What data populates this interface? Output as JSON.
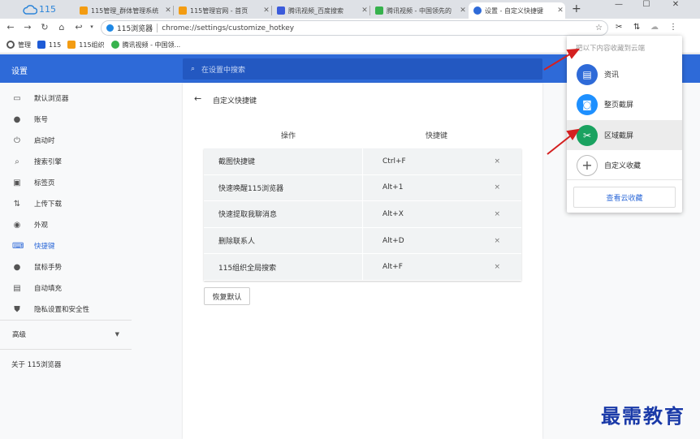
{
  "browser": {
    "logo_text": "115",
    "tabs": [
      {
        "title": "115管理_群体管理系统",
        "icon_color": "#f39c12"
      },
      {
        "title": "115管理官网 - 首页",
        "icon_color": "#f39c12"
      },
      {
        "title": "腾讯视频_百度搜索",
        "icon_color": "#3b5bdb"
      },
      {
        "title": "腾讯视频 - 中国领先的",
        "icon_color": "#37b24d"
      },
      {
        "title": "设置 - 自定义快捷键",
        "icon_color": "#2e6ad8"
      }
    ],
    "site_name": "115浏览器",
    "url": "chrome://settings/customize_hotkey",
    "bookmarks": [
      {
        "label": "管理",
        "icon": "gear-icon",
        "color": "#555555"
      },
      {
        "label": "115",
        "icon": "115-icon",
        "color": "#1e5bd6"
      },
      {
        "label": "115组织",
        "icon": "org-icon",
        "color": "#f39c12"
      },
      {
        "label": "腾讯视频 - 中国领...",
        "icon": "video-icon",
        "color": "#37b24d"
      }
    ]
  },
  "settings": {
    "header_title": "设置",
    "search_placeholder": "在设置中搜索",
    "sidebar": [
      {
        "label": "默认浏览器",
        "icon": "browser-icon",
        "glyph": "▭"
      },
      {
        "label": "账号",
        "icon": "person-icon",
        "glyph": "●"
      },
      {
        "label": "启动时",
        "icon": "power-icon",
        "glyph": "⏻"
      },
      {
        "label": "搜索引擎",
        "icon": "search-icon",
        "glyph": "⌕"
      },
      {
        "label": "标签页",
        "icon": "tabs-icon",
        "glyph": "▣"
      },
      {
        "label": "上传下载",
        "icon": "updown-icon",
        "glyph": "⇅"
      },
      {
        "label": "外观",
        "icon": "palette-icon",
        "glyph": "◉"
      },
      {
        "label": "快捷键",
        "icon": "keyboard-icon",
        "glyph": "⌨"
      },
      {
        "label": "鼠标手势",
        "icon": "mouse-icon",
        "glyph": "●"
      },
      {
        "label": "自动填充",
        "icon": "clipboard-icon",
        "glyph": "▤"
      },
      {
        "label": "隐私设置和安全性",
        "icon": "shield-icon",
        "glyph": "⛊"
      }
    ],
    "advanced_label": "高级",
    "about_label": "关于 115浏览器",
    "page_title": "自定义快捷键",
    "col_action": "操作",
    "col_hotkey": "快捷键",
    "rows": [
      {
        "action": "截图快捷键",
        "key": "Ctrl+F"
      },
      {
        "action": "快速唤醒115浏览器",
        "key": "Alt+1"
      },
      {
        "action": "快速提取我聊消息",
        "key": "Alt+X"
      },
      {
        "action": "删除联系人",
        "key": "Alt+D"
      },
      {
        "action": "115组织全局搜索",
        "key": "Alt+F"
      }
    ],
    "remove_glyph": "×",
    "reset_label": "恢复默认"
  },
  "popup": {
    "header": "把以下内容收藏到云端",
    "items": [
      {
        "label": "资讯",
        "icon": "news-icon",
        "color": "#2e6ad8",
        "glyph": "▤"
      },
      {
        "label": "整页截屏",
        "icon": "camera-icon",
        "color": "#1e90ff",
        "glyph": "◙"
      },
      {
        "label": "区域截屏",
        "icon": "crop-icon",
        "color": "#1aa260",
        "glyph": "✂"
      },
      {
        "label": "自定义收藏",
        "icon": "plus-icon",
        "color": "#ffffff",
        "glyph": "+"
      }
    ],
    "view_button": "查看云收藏"
  },
  "watermark": "最需教育"
}
